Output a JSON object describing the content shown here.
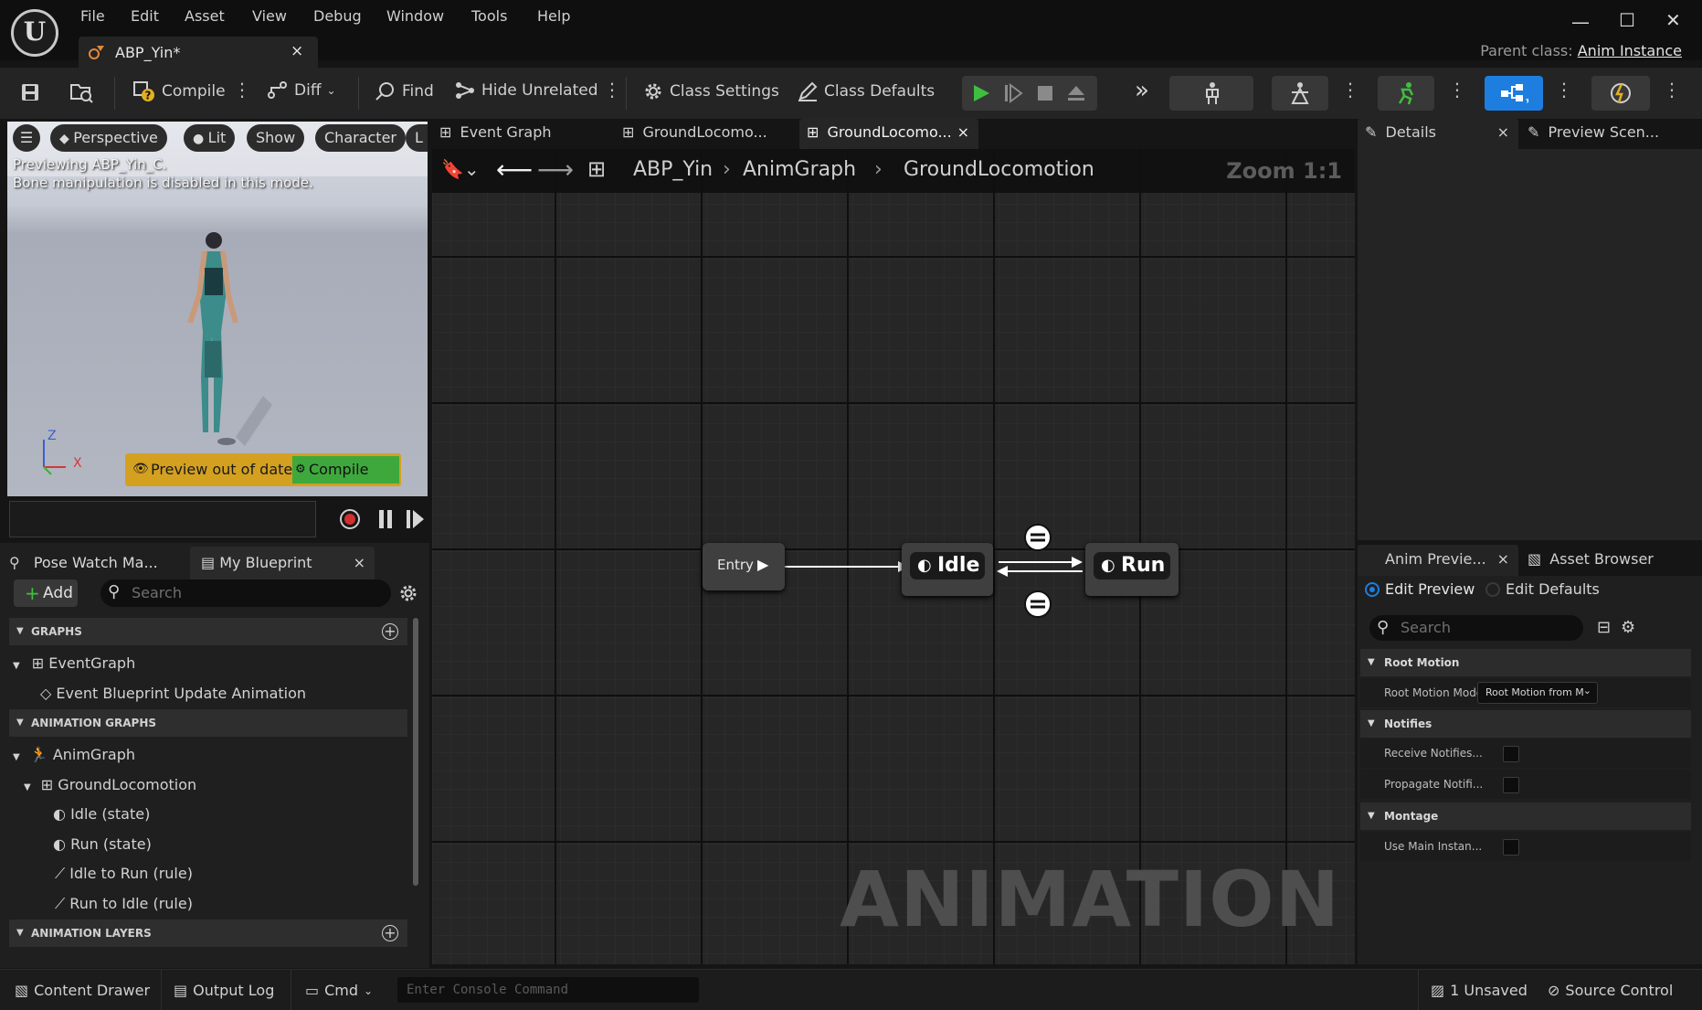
{
  "title_bar": {
    "menu": [
      "File",
      "Edit",
      "Asset",
      "View",
      "Debug",
      "Window",
      "Tools",
      "Help"
    ],
    "asset_tab": "ABP_Yin*",
    "parent_class_label": "Parent class:",
    "parent_class_value": "Anim Instance"
  },
  "toolbar": {
    "compile": "Compile",
    "diff": "Diff",
    "find": "Find",
    "hide_unrelated": "Hide Unrelated",
    "class_settings": "Class Settings",
    "class_defaults": "Class Defaults"
  },
  "viewport": {
    "perspective": "Perspective",
    "lit": "Lit",
    "show": "Show",
    "character": "Character",
    "truncated": "L",
    "previewing": "Previewing ABP_Yin_C.",
    "bone_msg": "Bone manipulation is disabled in this mode.",
    "preview_out_of_date": "Preview out of date",
    "compile": "Compile",
    "axis_z": "Z",
    "axis_x": "X"
  },
  "left_panel": {
    "tab_pose_watch": "Pose Watch Ma...",
    "tab_my_blueprint": "My Blueprint",
    "add": "Add",
    "search_placeholder": "Search",
    "sections": {
      "graphs": "GRAPHS",
      "animation_graphs": "ANIMATION GRAPHS",
      "animation_layers": "ANIMATION LAYERS"
    },
    "items": {
      "event_graph": "EventGraph",
      "event_bp_update": "Event Blueprint Update Animation",
      "anim_graph": "AnimGraph",
      "ground_locomotion": "GroundLocomotion",
      "idle_state": "Idle (state)",
      "run_state": "Run (state)",
      "idle_to_run": "Idle to Run (rule)",
      "run_to_idle": "Run to Idle (rule)"
    }
  },
  "graph": {
    "tabs": [
      "Event Graph",
      "GroundLocomo...",
      "GroundLocomo..."
    ],
    "breadcrumb": [
      "ABP_Yin",
      "AnimGraph",
      "GroundLocomotion"
    ],
    "zoom": "Zoom 1:1",
    "watermark": "ANIMATION",
    "nodes": {
      "entry": "Entry",
      "idle": "Idle",
      "run": "Run"
    }
  },
  "details": {
    "tab_details": "Details",
    "tab_preview_scene": "Preview Scen..."
  },
  "anim_preview": {
    "tab_anim_preview": "Anim Previe...",
    "tab_asset_browser": "Asset Browser",
    "edit_preview": "Edit Preview",
    "edit_defaults": "Edit Defaults",
    "search_placeholder": "Search",
    "root_motion_head": "Root Motion",
    "root_motion_mode_label": "Root Motion Mode",
    "root_motion_mode_value": "Root Motion from M",
    "notifies_head": "Notifies",
    "receive_notifies": "Receive Notifies...",
    "propagate_notifies": "Propagate Notifi...",
    "montage_head": "Montage",
    "use_main_instance": "Use Main Instan..."
  },
  "status_bar": {
    "content_drawer": "Content Drawer",
    "output_log": "Output Log",
    "cmd": "Cmd",
    "console_placeholder": "Enter Console Command",
    "unsaved": "1 Unsaved",
    "source_control": "Source Control"
  },
  "colors": {
    "play_green": "#3fbf3f",
    "accent_blue": "#1d7ee0",
    "warning_yellow": "#d4a020",
    "compile_green": "#3fa83d"
  }
}
